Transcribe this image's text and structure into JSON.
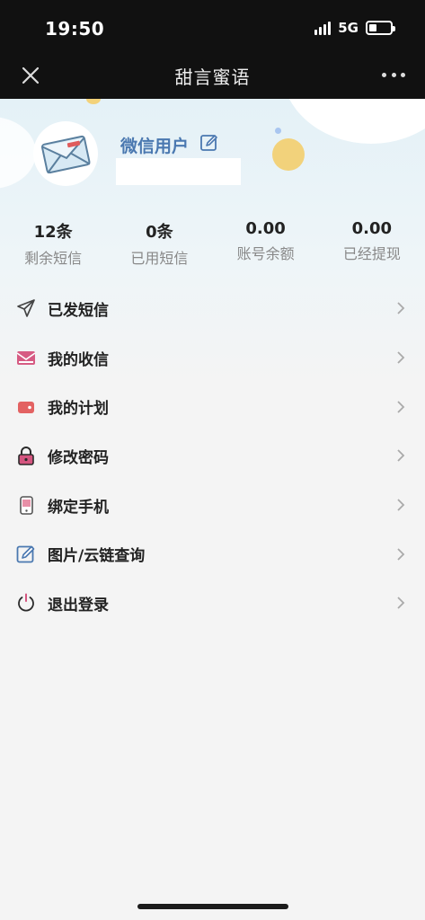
{
  "status_bar": {
    "time": "19:50",
    "network": "5G"
  },
  "nav": {
    "title": "甜言蜜语"
  },
  "profile": {
    "username": "微信用户"
  },
  "stats": [
    {
      "value": "12条",
      "label": "剩余短信"
    },
    {
      "value": "0条",
      "label": "已用短信"
    },
    {
      "value": "0.00",
      "label": "账号余额"
    },
    {
      "value": "0.00",
      "label": "已经提现"
    }
  ],
  "menu": [
    {
      "label": "已发短信",
      "icon": "send-icon"
    },
    {
      "label": "我的收信",
      "icon": "inbox-envelope-icon"
    },
    {
      "label": "我的计划",
      "icon": "wallet-icon"
    },
    {
      "label": "修改密码",
      "icon": "lock-icon"
    },
    {
      "label": "绑定手机",
      "icon": "phone-icon"
    },
    {
      "label": "图片/云链查询",
      "icon": "edit-square-icon"
    },
    {
      "label": "退出登录",
      "icon": "power-icon"
    }
  ],
  "colors": {
    "username": "#4a78b0",
    "accent_pink": "#e0668a",
    "accent_red": "#e05c5c"
  }
}
